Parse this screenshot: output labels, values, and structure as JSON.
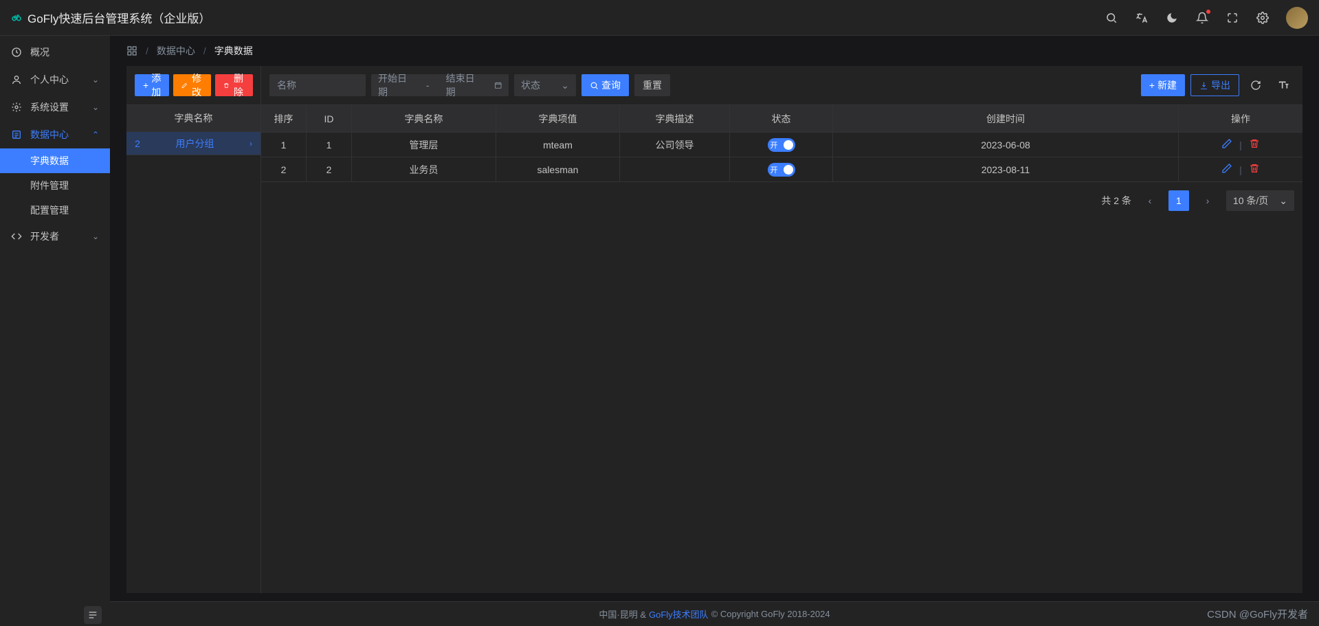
{
  "header": {
    "title": "GoFly快速后台管理系统（企业版）"
  },
  "sidebar": {
    "items": [
      {
        "label": "概况",
        "expandable": false
      },
      {
        "label": "个人中心",
        "expandable": true
      },
      {
        "label": "系统设置",
        "expandable": true
      },
      {
        "label": "数据中心",
        "expandable": true,
        "active": true
      },
      {
        "label": "开发者",
        "expandable": true
      }
    ],
    "sub_items": [
      {
        "label": "字典数据",
        "selected": true
      },
      {
        "label": "附件管理"
      },
      {
        "label": "配置管理"
      }
    ]
  },
  "breadcrumb": {
    "items": [
      "数据中心",
      "字典数据"
    ]
  },
  "left_panel": {
    "add": "添加",
    "edit": "修改",
    "delete": "删除",
    "header": "字典名称",
    "rows": [
      {
        "idx": "2",
        "name": "用户分组"
      }
    ]
  },
  "filters": {
    "name_placeholder": "名称",
    "start_date": "开始日期",
    "end_date": "结束日期",
    "status": "状态",
    "search": "查询",
    "reset": "重置",
    "create": "新建",
    "export": "导出"
  },
  "table": {
    "headers": {
      "sort": "排序",
      "id": "ID",
      "name": "字典名称",
      "value": "字典项值",
      "desc": "字典描述",
      "status": "状态",
      "time": "创建时间",
      "op": "操作"
    },
    "switch_on": "开",
    "rows": [
      {
        "sort": "1",
        "id": "1",
        "name": "管理层",
        "value": "mteam",
        "desc": "公司领导",
        "time": "2023-06-08"
      },
      {
        "sort": "2",
        "id": "2",
        "name": "业务员",
        "value": "salesman",
        "desc": "",
        "time": "2023-08-11"
      }
    ]
  },
  "pagination": {
    "total": "共 2 条",
    "page": "1",
    "size": "10 条/页"
  },
  "footer": {
    "loc": "中国·昆明 &",
    "team": "GoFly技术团队",
    "copy": "© Copyright GoFly 2018-2024",
    "watermark": "CSDN @GoFly开发者"
  }
}
